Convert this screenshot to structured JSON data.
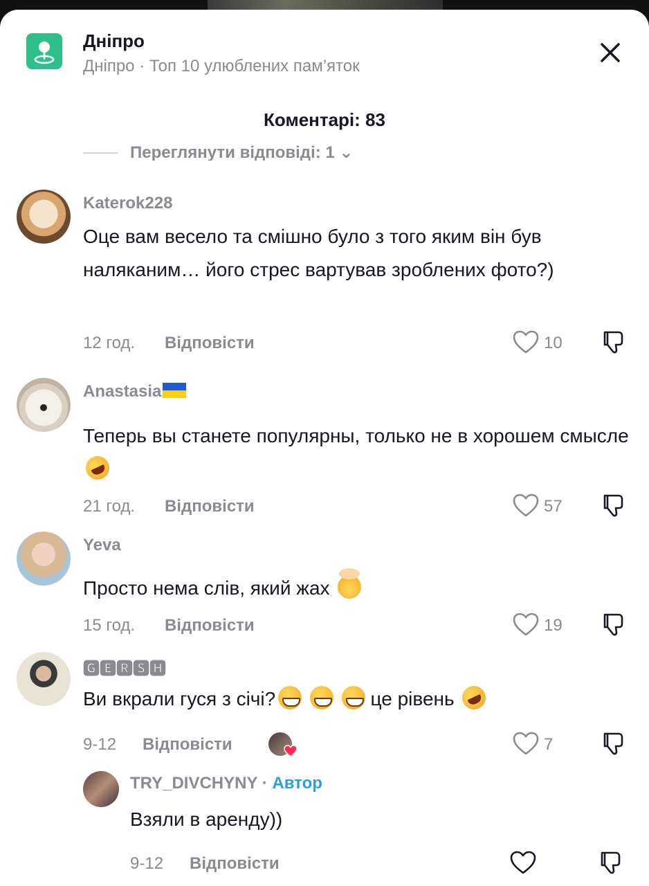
{
  "header": {
    "title": "Дніпро",
    "subtitle": "Дніпро · Топ 10 улюблених пам’яток",
    "icon": "location-pin-icon",
    "icon_color": "#2ebf8a"
  },
  "comments_count": "Коментарі: 83",
  "cut_row": {
    "text": "Переглянути відповіді: 1"
  },
  "reply_label": "Відповісти",
  "comments": [
    {
      "username": "Katerok228",
      "text": "Оце вам весело та смішно було з того яким він був наляканим… його стрес вартував зроблених фото?)",
      "time": "12 год.",
      "likes": "10"
    },
    {
      "username": "Anastasia",
      "username_emoji": "ukraine-flag-icon",
      "text": "Теперь вы станете популярны, только не в хорошем смысле",
      "text_emoji": "rofl-emoji",
      "time": "21 год.",
      "likes": "57"
    },
    {
      "username": "Yeva",
      "text": "Просто нема слів, який жах",
      "text_emoji": "mind-blown-emoji",
      "time": "15 год.",
      "likes": "19"
    },
    {
      "username": "🅶🅴🆁🆂🅷",
      "text_a": "Ви вкрали гуся з січі?",
      "text_b": "це рівень",
      "time": "9-12",
      "likes": "7",
      "creator_liked": true
    }
  ],
  "reply": {
    "username": "TRY_DIVCHYNY",
    "separator": " · ",
    "author_label": "Автор",
    "text": "Взяли в аренду))",
    "time": "9-12"
  },
  "colors": {
    "text": "#161823",
    "muted": "#8a8b91",
    "author": "#2b9fd8",
    "heart": "#fe2c55"
  }
}
